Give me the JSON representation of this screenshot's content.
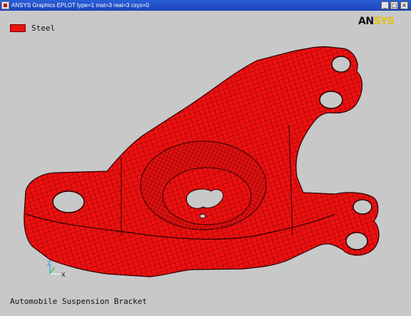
{
  "window": {
    "title": "ANSYS Graphics   EPLOT   type=1 mat=3 real=3 csys=0",
    "minimize_glyph": "_",
    "maximize_glyph": "□",
    "close_glyph": "×"
  },
  "legend": {
    "label": "Steel",
    "color": "#ee1010"
  },
  "logo": {
    "part1": "AN",
    "part2": "SYS"
  },
  "triad": {
    "z_label": "Z",
    "y_label": "Y",
    "x_label": "X"
  },
  "caption": "Automobile Suspension Bracket",
  "colors": {
    "background": "#c8c8c8",
    "mesh_fill": "#ee1010",
    "mesh_lines": "#3a0000",
    "titlebar": "#2a5fd8"
  }
}
